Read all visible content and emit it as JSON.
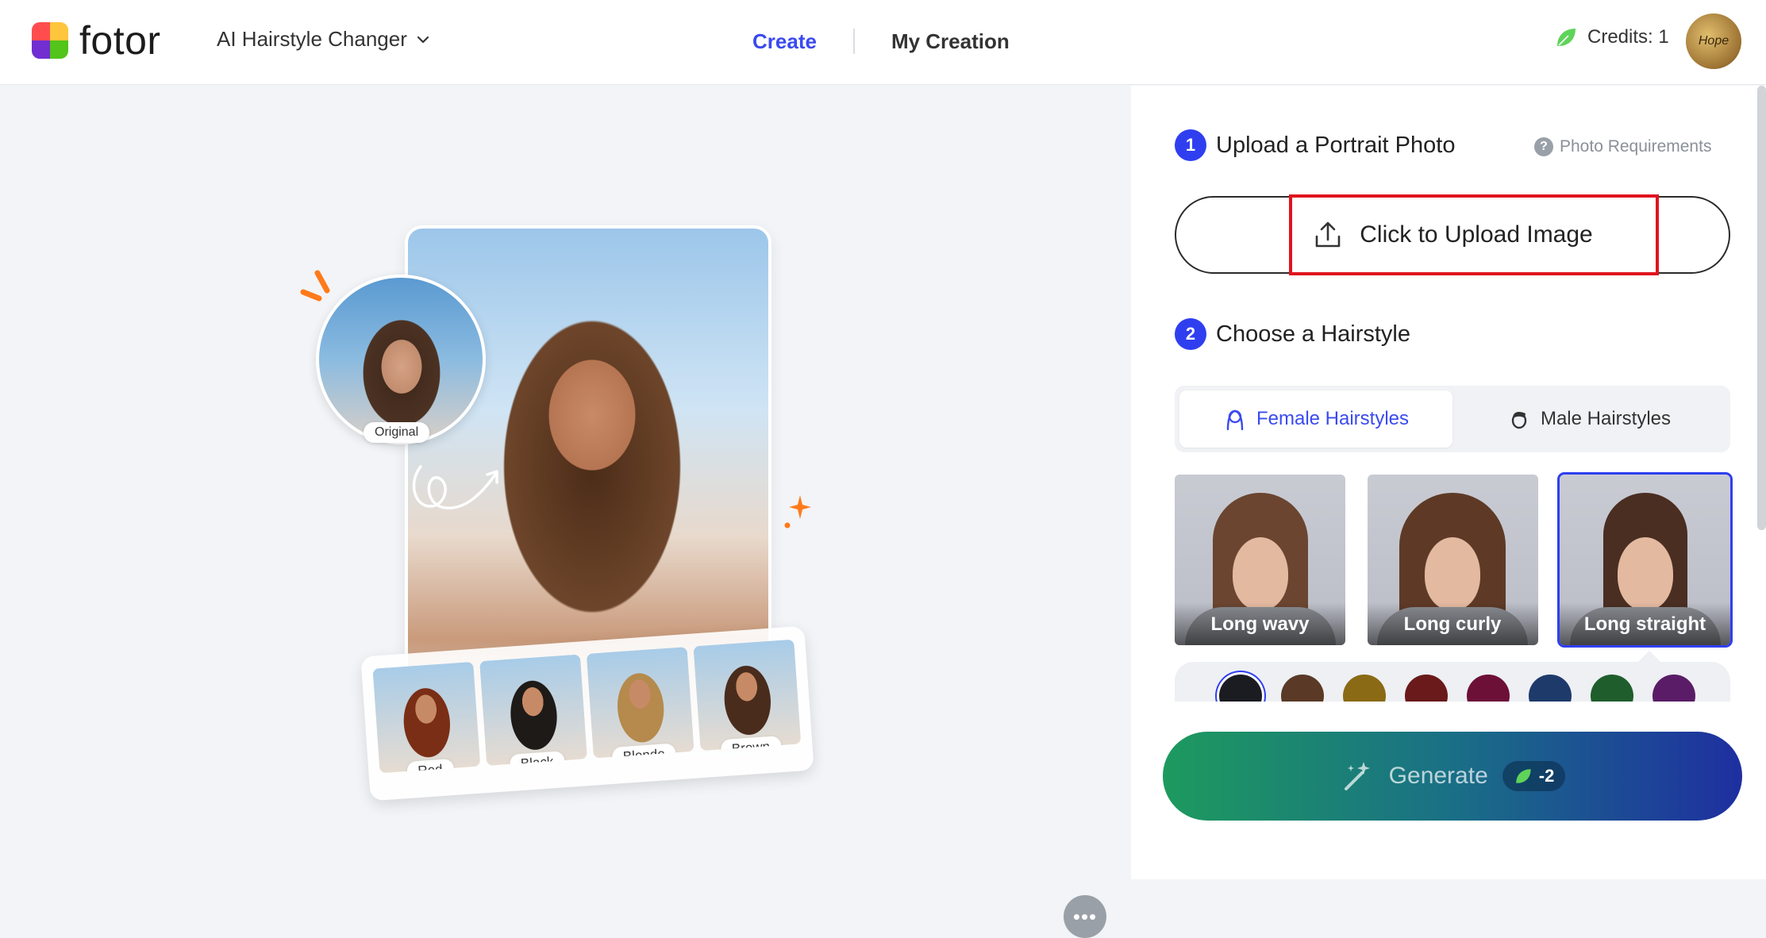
{
  "header": {
    "logo_text": "fotor",
    "tool_name": "AI Hairstyle Changer",
    "nav": [
      {
        "label": "Create",
        "active": true
      },
      {
        "label": "My Creation",
        "active": false
      }
    ],
    "credits_label": "Credits: 1",
    "avatar_text": "Hope"
  },
  "preview": {
    "original_label": "Original",
    "thumbnails": [
      {
        "label": "Red"
      },
      {
        "label": "Black"
      },
      {
        "label": "Blonde"
      },
      {
        "label": "Brown"
      }
    ],
    "more_icon": "ellipsis-icon"
  },
  "panel": {
    "step1": {
      "number": "1",
      "title": "Upload a Portrait Photo",
      "requirements_label": "Photo Requirements"
    },
    "upload_label": "Click to Upload Image",
    "step2": {
      "number": "2",
      "title": "Choose a Hairstyle"
    },
    "tabs": [
      {
        "label": "Female Hairstyles",
        "active": true
      },
      {
        "label": "Male Hairstyles",
        "active": false
      }
    ],
    "styles": [
      {
        "label": "Long wavy",
        "selected": false
      },
      {
        "label": "Long curly",
        "selected": false
      },
      {
        "label": "Long straight",
        "selected": true
      }
    ],
    "hair_colors": [
      "#1b1b22",
      "#5a3a26",
      "#8a6a14",
      "#6a1a1a",
      "#6d1038",
      "#1e3a6b",
      "#1f5e2c",
      "#5a1c66"
    ],
    "generate_label": "Generate",
    "generate_cost": "-2"
  },
  "colors": {
    "accent": "#2f3ff0",
    "highlight": "#e0141e"
  }
}
